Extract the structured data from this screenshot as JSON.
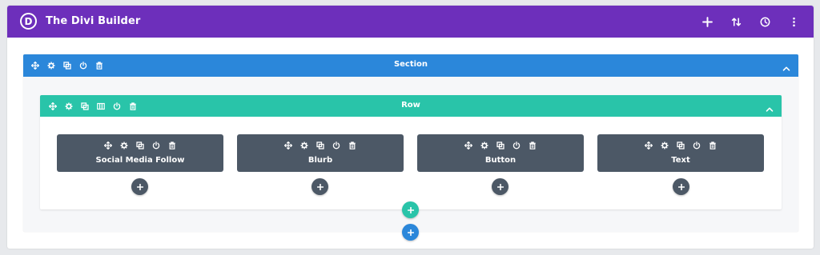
{
  "app": {
    "logo_letter": "D",
    "title": "The Divi Builder"
  },
  "colors": {
    "topbar": "#6d2fbb",
    "section": "#2b87da",
    "row": "#29c4a9",
    "module": "#4c5866"
  },
  "topbar_actions": [
    {
      "name": "add-icon"
    },
    {
      "name": "sort-arrows-icon"
    },
    {
      "name": "history-clock-icon"
    },
    {
      "name": "more-vertical-icon"
    }
  ],
  "section": {
    "label": "Section"
  },
  "row": {
    "label": "Row"
  },
  "modules": [
    {
      "label": "Social Media Follow"
    },
    {
      "label": "Blurb"
    },
    {
      "label": "Button"
    },
    {
      "label": "Text"
    }
  ]
}
